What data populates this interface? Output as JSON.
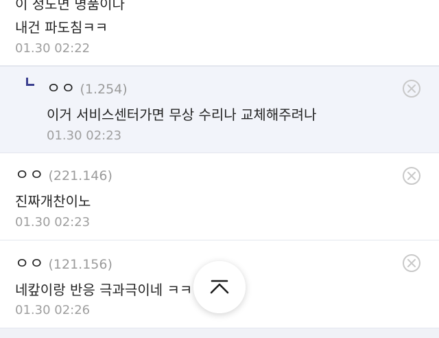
{
  "comments": [
    {
      "partial_text": "이 정도면 명품이다",
      "text": "내건 파도침ㅋㅋ",
      "time": "01.30 02:22"
    },
    {
      "nick": "ㅇㅇ",
      "ip": "(1.254)",
      "text": "이거 서비스센터가면 무상 수리나 교체해주려나",
      "time": "01.30 02:23",
      "is_reply": true
    },
    {
      "nick": "ㅇㅇ",
      "ip": "(221.146)",
      "text": "진짜개찬이노",
      "time": "01.30 02:23"
    },
    {
      "nick": "ㅇㅇ",
      "ip": "(121.156)",
      "text": "네캎이랑 반응 극과극이네 ㅋㅋ",
      "time": "01.30 02:26"
    }
  ],
  "icons": {
    "delete": "close-circle-icon",
    "reply": "reply-arrow-icon",
    "scroll_top": "chevron-up-icon"
  },
  "colors": {
    "reply_background": "#f2f4fa",
    "reply_mark": "#3b3f8f",
    "divider": "#e3e6ee",
    "muted_text": "#9e9e9e"
  }
}
